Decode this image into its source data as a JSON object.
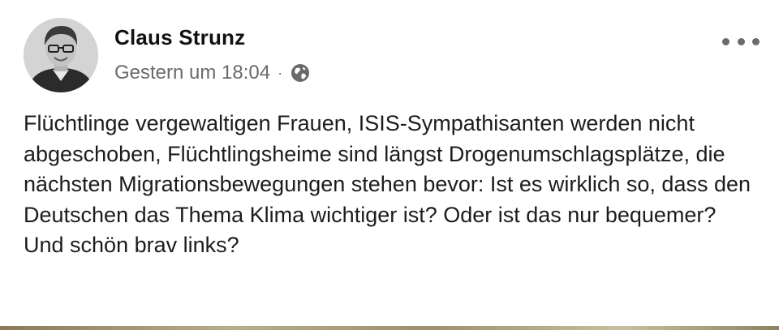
{
  "post": {
    "author": "Claus Strunz",
    "timestamp": "Gestern um 18:04",
    "separator": "·",
    "audience_icon": "globe-icon",
    "more_icon": "more-options-icon",
    "text": "Flüchtlinge vergewaltigen Frauen, ISIS-Sympathisanten werden nicht abgeschoben, Flüchtlingsheime sind längst Drogenumschlagsplätze, die nächsten Migrationsbewegungen stehen bevor: Ist es wirklich so, dass den Deutschen das Thema Klima wichtiger ist? Oder ist das nur bequemer? Und schön brav links?"
  }
}
